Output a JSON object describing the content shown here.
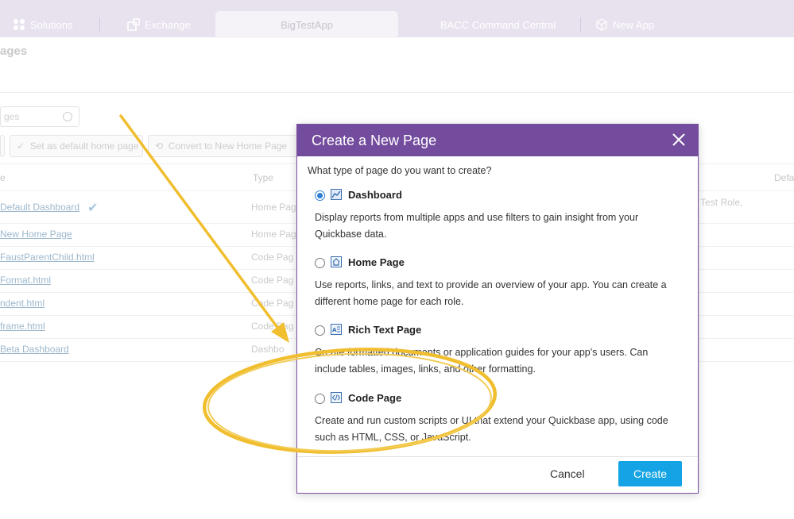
{
  "tabs": [
    {
      "label": "Solutions",
      "icon": "grid-icon"
    },
    {
      "label": "Exchange",
      "icon": "exchange-icon"
    },
    {
      "label": "BigTestApp",
      "icon": ""
    },
    {
      "label": "BACC Command Central",
      "icon": ""
    },
    {
      "label": "New App",
      "icon": "cube-icon"
    }
  ],
  "page": {
    "title": "ages",
    "search_placeholder": "ges",
    "set_default_label": "Set as default home page",
    "convert_label": "Convert to New Home Page"
  },
  "table": {
    "headers": [
      "e",
      "Type",
      "Defa"
    ],
    "rows": [
      {
        "name": "Default Dashboard",
        "type": "Home Pag",
        "role": "s Test Role,",
        "checked": true
      },
      {
        "name": "New Home Page",
        "type": "Home Pag",
        "role": ""
      },
      {
        "name": "FaustParentChild.html",
        "type": "Code Pag",
        "role": ""
      },
      {
        "name": "Format.html",
        "type": "Code Pag",
        "role": ""
      },
      {
        "name": "ndent.html",
        "type": "Code Pag",
        "role": ""
      },
      {
        "name": "frame.html",
        "type": "Code Pag",
        "role": ""
      },
      {
        "name": "Beta Dashboard",
        "type": "Dashbo",
        "role": ""
      }
    ]
  },
  "modal": {
    "title": "Create a New Page",
    "question": "What type of page do you want to create?",
    "options": [
      {
        "label": "Dashboard",
        "icon": "dashboard-icon",
        "selected": true,
        "desc": "Display reports from multiple apps and use filters to gain insight from your Quickbase data."
      },
      {
        "label": "Home Page",
        "icon": "home-icon",
        "selected": false,
        "desc": "Use reports, links, and text to provide an overview of your app. You can create a different home page for each role."
      },
      {
        "label": "Rich Text Page",
        "icon": "rich-text-icon",
        "selected": false,
        "desc": "Create formatted documents or application guides for your app's users. Can include tables, images, links, and other formatting."
      },
      {
        "label": "Code Page",
        "icon": "code-icon",
        "selected": false,
        "desc": "Create and run custom scripts or UI that extend your Quickbase app, using code such as HTML, CSS, or JavaScript."
      }
    ],
    "cancel_label": "Cancel",
    "create_label": "Create"
  },
  "colors": {
    "modal_header": "#744c9e",
    "create_button": "#14a3e4",
    "annotation": "#f0be2e"
  }
}
